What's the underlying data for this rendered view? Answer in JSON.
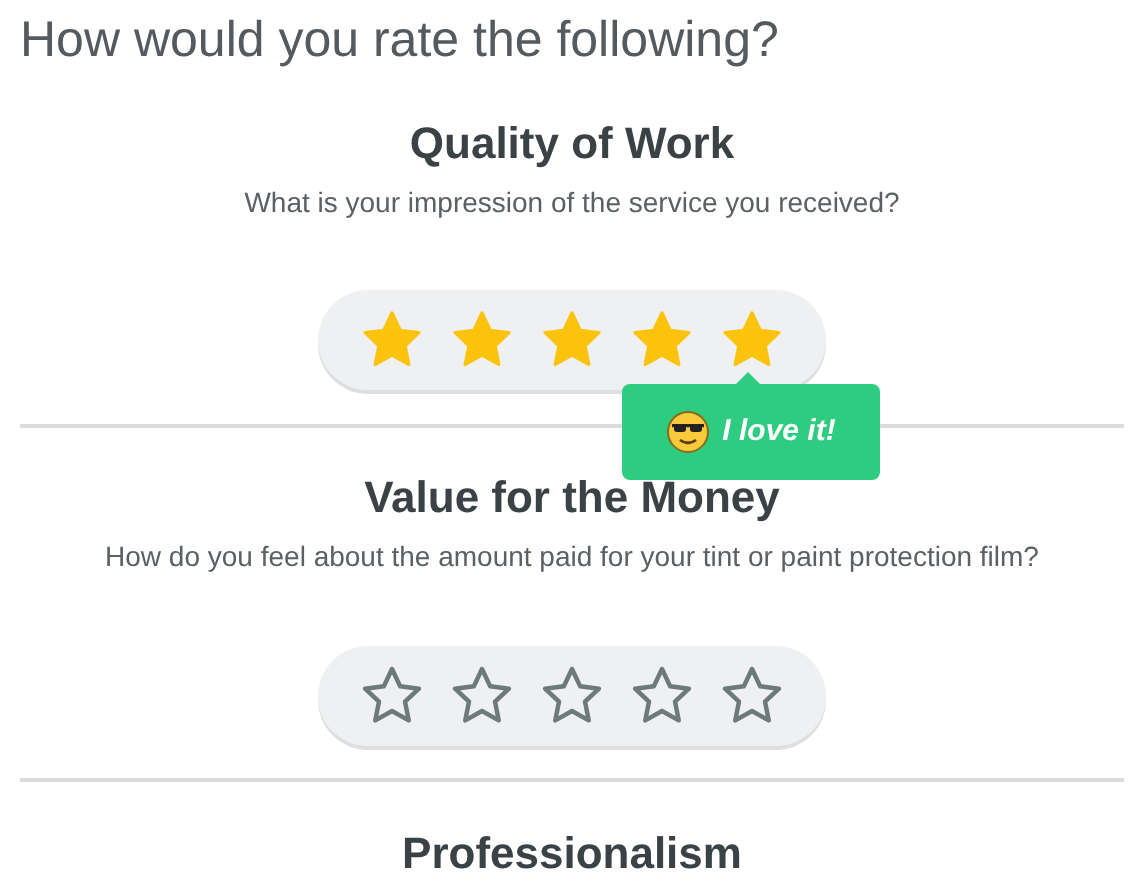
{
  "heading": "How would you rate the following?",
  "questions": [
    {
      "title": "Quality of Work",
      "subtitle": "What is your impression of the service you received?",
      "stars": 5,
      "tooltip": "I love it!"
    },
    {
      "title": "Value for the Money",
      "subtitle": "How do you feel about the amount paid for your tint or paint protection film?",
      "stars": 0
    },
    {
      "title": "Professionalism"
    }
  ]
}
